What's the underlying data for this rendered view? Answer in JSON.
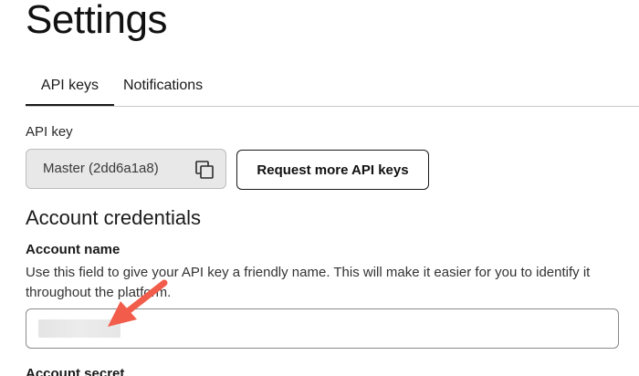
{
  "page": {
    "title": "Settings"
  },
  "tabs": [
    {
      "label": "API keys",
      "active": true
    },
    {
      "label": "Notifications",
      "active": false
    }
  ],
  "api_key": {
    "label": "API key",
    "selected_value": "Master (2dd6a1a8)",
    "copy_icon": "copy-icon",
    "request_button_label": "Request more API keys"
  },
  "account_credentials": {
    "heading": "Account credentials",
    "account_name": {
      "label": "Account name",
      "help_text": "Use this field to give your API key a friendly name. This will make it easier for you to identify it throughout the platform.",
      "value": ""
    },
    "account_secret": {
      "label": "Account secret"
    }
  },
  "annotation": {
    "arrow_icon": "arrow-icon",
    "arrow_color": "#f25c4a"
  },
  "colors": {
    "text": "#1a1a1a",
    "select_bg": "#e8e8e8",
    "border": "#bdbdbd",
    "accent_arrow": "#f25c4a"
  }
}
